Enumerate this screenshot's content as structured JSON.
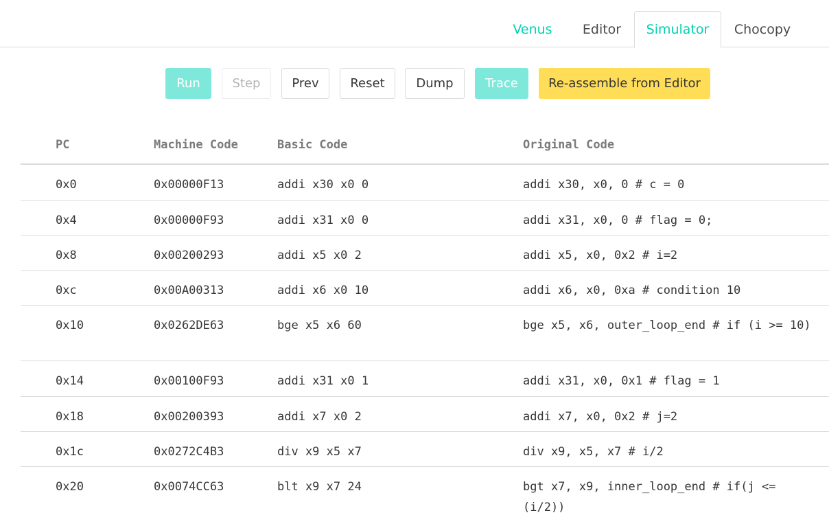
{
  "tabs": [
    {
      "label": "Venus"
    },
    {
      "label": "Editor"
    },
    {
      "label": "Simulator"
    },
    {
      "label": "Chocopy"
    }
  ],
  "toolbar": {
    "run": "Run",
    "step": "Step",
    "prev": "Prev",
    "reset": "Reset",
    "dump": "Dump",
    "trace": "Trace",
    "reassemble": "Re-assemble from Editor"
  },
  "table": {
    "headers": {
      "pc": "PC",
      "machine_code": "Machine Code",
      "basic_code": "Basic Code",
      "original_code": "Original Code"
    },
    "rows": [
      {
        "pc": "0x0",
        "machine_code": "0x00000F13",
        "basic_code": "addi x30 x0 0",
        "original_code": "addi x30, x0, 0 # c = 0"
      },
      {
        "pc": "0x4",
        "machine_code": "0x00000F93",
        "basic_code": "addi x31 x0 0",
        "original_code": "addi x31, x0, 0 # flag = 0;"
      },
      {
        "pc": "0x8",
        "machine_code": "0x00200293",
        "basic_code": "addi x5 x0 2",
        "original_code": "addi x5, x0, 0x2 # i=2"
      },
      {
        "pc": "0xc",
        "machine_code": "0x00A00313",
        "basic_code": "addi x6 x0 10",
        "original_code": "addi x6, x0, 0xa # condition 10"
      },
      {
        "pc": "0x10",
        "machine_code": "0x0262DE63",
        "basic_code": "bge x5 x6 60",
        "original_code": "bge x5, x6, outer_loop_end # if (i >= 10)"
      },
      {
        "pc": "0x14",
        "machine_code": "0x00100F93",
        "basic_code": "addi x31 x0 1",
        "original_code": "addi x31, x0, 0x1 # flag = 1"
      },
      {
        "pc": "0x18",
        "machine_code": "0x00200393",
        "basic_code": "addi x7 x0 2",
        "original_code": "addi x7, x0, 0x2 # j=2"
      },
      {
        "pc": "0x1c",
        "machine_code": "0x0272C4B3",
        "basic_code": "div x9 x5 x7",
        "original_code": "div x9, x5, x7 # i/2"
      },
      {
        "pc": "0x20",
        "machine_code": "0x0074CC63",
        "basic_code": "blt x9 x7 24",
        "original_code": "bgt x7, x9, inner_loop_end # if(j <= (i/2))"
      }
    ]
  }
}
